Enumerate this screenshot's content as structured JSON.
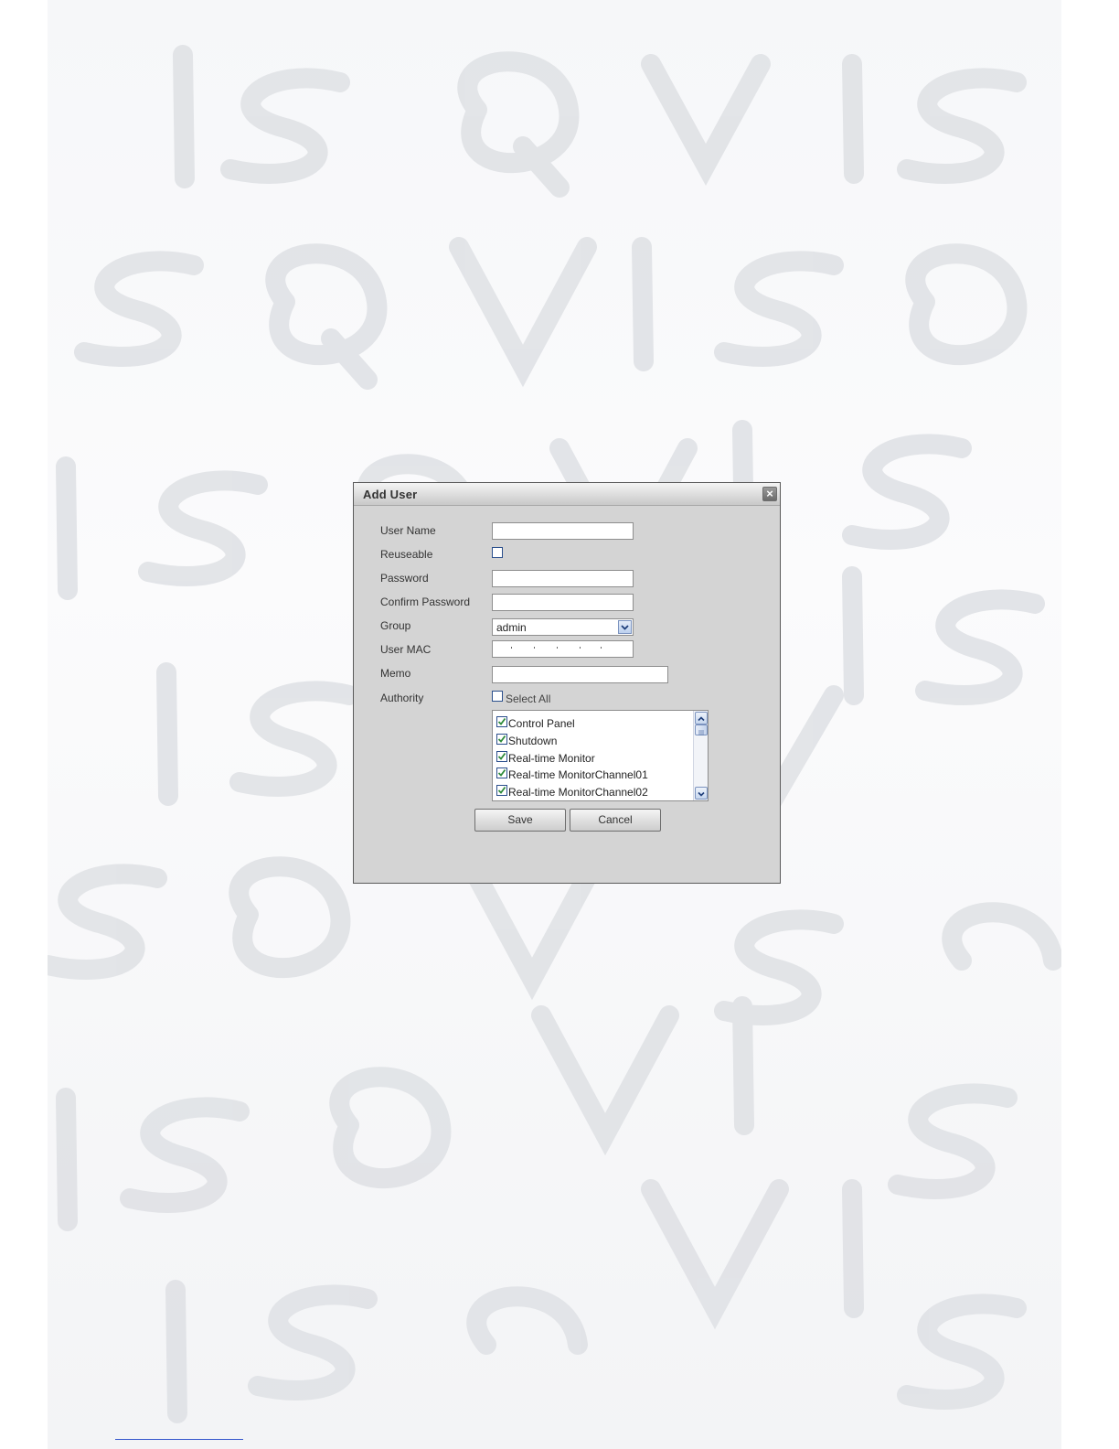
{
  "dialog": {
    "title": "Add User",
    "close_icon": "close-icon"
  },
  "form": {
    "user_name_label": "User Name",
    "user_name_value": "",
    "reuseable_label": "Reuseable",
    "reuseable_checked": false,
    "password_label": "Password",
    "password_value": "",
    "confirm_password_label": "Confirm Password",
    "confirm_password_value": "",
    "group_label": "Group",
    "group_value": "admin",
    "user_mac_label": "User MAC",
    "user_mac_value": "",
    "memo_label": "Memo",
    "memo_value": "",
    "authority_label": "Authority",
    "select_all_label": "Select All",
    "select_all_checked": false
  },
  "authority_items": [
    {
      "label": "Control Panel",
      "checked": true
    },
    {
      "label": "Shutdown",
      "checked": true
    },
    {
      "label": "Real-time Monitor",
      "checked": true
    },
    {
      "label": "Real-time MonitorChannel01",
      "checked": true
    },
    {
      "label": "Real-time MonitorChannel02",
      "checked": true
    }
  ],
  "buttons": {
    "save_label": "Save",
    "cancel_label": "Cancel"
  },
  "watermark": {
    "text": "ISQVISQVIS",
    "color": "#e2e4e8"
  },
  "colors": {
    "dialog_bg": "#d4d4d4",
    "check_green": "#2e8b3a",
    "checkbox_border": "#2b4f8c"
  }
}
